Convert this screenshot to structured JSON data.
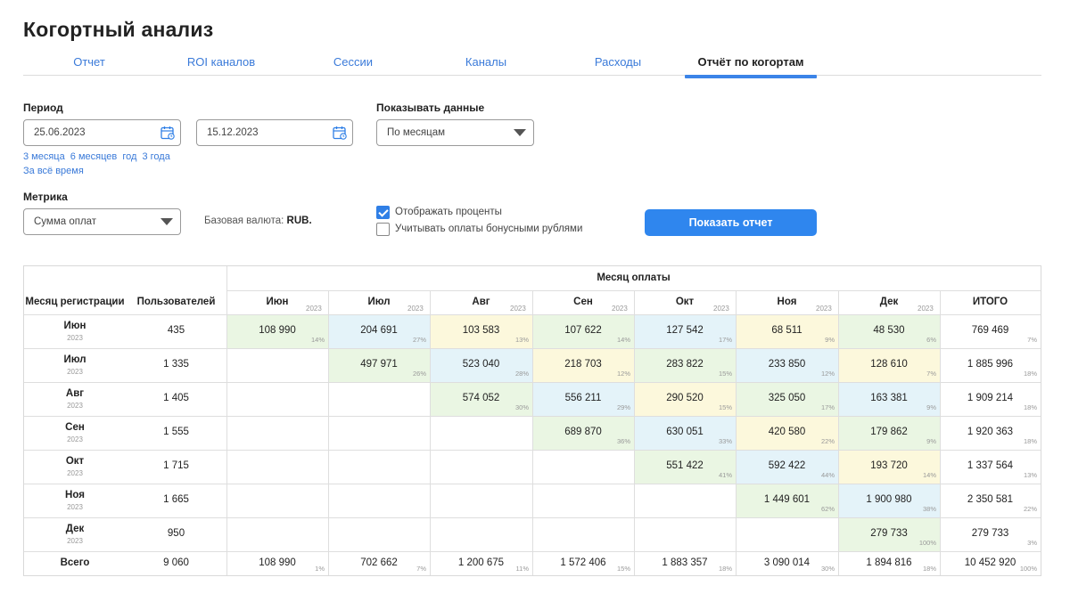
{
  "page": {
    "title": "Когортный анализ"
  },
  "tabs": [
    {
      "label": "Отчет",
      "active": false
    },
    {
      "label": "ROI каналов",
      "active": false
    },
    {
      "label": "Сессии",
      "active": false
    },
    {
      "label": "Каналы",
      "active": false
    },
    {
      "label": "Расходы",
      "active": false
    },
    {
      "label": "Отчёт по когортам",
      "active": true
    }
  ],
  "filters": {
    "period_label": "Период",
    "date_from": "25.06.2023",
    "date_to": "15.12.2023",
    "quick_links": [
      "3 месяца",
      "6 месяцев",
      "год",
      "3 года",
      "За всё время"
    ],
    "show_data_label": "Показывать данные",
    "show_data_value": "По месяцам",
    "metric_label": "Метрика",
    "metric_value": "Сумма оплат",
    "currency_prefix": "Базовая валюта:",
    "currency_value": "RUB.",
    "checkbox_percent": {
      "label": "Отображать проценты",
      "checked": true
    },
    "checkbox_bonus": {
      "label": "Учитывать оплаты бонусными рублями",
      "checked": false
    },
    "show_button": "Показать отчет"
  },
  "colors": {
    "green": "#eaf6e3",
    "blue": "#e4f3f9",
    "yellow": "#fcf8dc",
    "accent": "#2f86ee"
  },
  "table": {
    "header": {
      "reg_month": "Месяц регистрации",
      "users": "Пользователей",
      "payment_month": "Месяц оплаты",
      "total": "ИТОГО"
    },
    "columns": [
      {
        "name": "Июн",
        "year": "2023"
      },
      {
        "name": "Июл",
        "year": "2023"
      },
      {
        "name": "Авг",
        "year": "2023"
      },
      {
        "name": "Сен",
        "year": "2023"
      },
      {
        "name": "Окт",
        "year": "2023"
      },
      {
        "name": "Ноя",
        "year": "2023"
      },
      {
        "name": "Дек",
        "year": "2023"
      }
    ],
    "rows": [
      {
        "name": "Июн",
        "year": "2023",
        "users": "435",
        "cells": [
          {
            "v": "108 990",
            "p": "14%",
            "c": "green"
          },
          {
            "v": "204 691",
            "p": "27%",
            "c": "blue"
          },
          {
            "v": "103 583",
            "p": "13%",
            "c": "yellow"
          },
          {
            "v": "107 622",
            "p": "14%",
            "c": "green"
          },
          {
            "v": "127 542",
            "p": "17%",
            "c": "blue"
          },
          {
            "v": "68 511",
            "p": "9%",
            "c": "yellow"
          },
          {
            "v": "48 530",
            "p": "6%",
            "c": "green"
          }
        ],
        "total": "769 469",
        "total_pct": "7%"
      },
      {
        "name": "Июл",
        "year": "2023",
        "users": "1 335",
        "cells": [
          null,
          {
            "v": "497 971",
            "p": "26%",
            "c": "green"
          },
          {
            "v": "523 040",
            "p": "28%",
            "c": "blue"
          },
          {
            "v": "218 703",
            "p": "12%",
            "c": "yellow"
          },
          {
            "v": "283 822",
            "p": "15%",
            "c": "green"
          },
          {
            "v": "233 850",
            "p": "12%",
            "c": "blue"
          },
          {
            "v": "128 610",
            "p": "7%",
            "c": "yellow"
          }
        ],
        "total": "1 885 996",
        "total_pct": "18%"
      },
      {
        "name": "Авг",
        "year": "2023",
        "users": "1 405",
        "cells": [
          null,
          null,
          {
            "v": "574 052",
            "p": "30%",
            "c": "green"
          },
          {
            "v": "556 211",
            "p": "29%",
            "c": "blue"
          },
          {
            "v": "290 520",
            "p": "15%",
            "c": "yellow"
          },
          {
            "v": "325 050",
            "p": "17%",
            "c": "green"
          },
          {
            "v": "163 381",
            "p": "9%",
            "c": "blue"
          }
        ],
        "total": "1 909 214",
        "total_pct": "18%"
      },
      {
        "name": "Сен",
        "year": "2023",
        "users": "1 555",
        "cells": [
          null,
          null,
          null,
          {
            "v": "689 870",
            "p": "36%",
            "c": "green"
          },
          {
            "v": "630 051",
            "p": "33%",
            "c": "blue"
          },
          {
            "v": "420 580",
            "p": "22%",
            "c": "yellow"
          },
          {
            "v": "179 862",
            "p": "9%",
            "c": "green"
          }
        ],
        "total": "1 920 363",
        "total_pct": "18%"
      },
      {
        "name": "Окт",
        "year": "2023",
        "users": "1 715",
        "cells": [
          null,
          null,
          null,
          null,
          {
            "v": "551 422",
            "p": "41%",
            "c": "green"
          },
          {
            "v": "592 422",
            "p": "44%",
            "c": "blue"
          },
          {
            "v": "193 720",
            "p": "14%",
            "c": "yellow"
          }
        ],
        "total": "1 337 564",
        "total_pct": "13%"
      },
      {
        "name": "Ноя",
        "year": "2023",
        "users": "1 665",
        "cells": [
          null,
          null,
          null,
          null,
          null,
          {
            "v": "1 449 601",
            "p": "62%",
            "c": "green"
          },
          {
            "v": "1 900 980",
            "p": "38%",
            "c": "blue"
          }
        ],
        "total": "2 350 581",
        "total_pct": "22%"
      },
      {
        "name": "Дек",
        "year": "2023",
        "users": "950",
        "cells": [
          null,
          null,
          null,
          null,
          null,
          null,
          {
            "v": "279 733",
            "p": "100%",
            "c": "green"
          }
        ],
        "total": "279 733",
        "total_pct": "3%"
      }
    ],
    "footer": {
      "label": "Всего",
      "users": "9 060",
      "cells": [
        {
          "v": "108 990",
          "p": "1%"
        },
        {
          "v": "702 662",
          "p": "7%"
        },
        {
          "v": "1 200 675",
          "p": "11%"
        },
        {
          "v": "1 572 406",
          "p": "15%"
        },
        {
          "v": "1 883 357",
          "p": "18%"
        },
        {
          "v": "3 090 014",
          "p": "30%"
        },
        {
          "v": "1 894 816",
          "p": "18%"
        }
      ],
      "total": "10 452 920",
      "total_pct": "100%"
    }
  }
}
